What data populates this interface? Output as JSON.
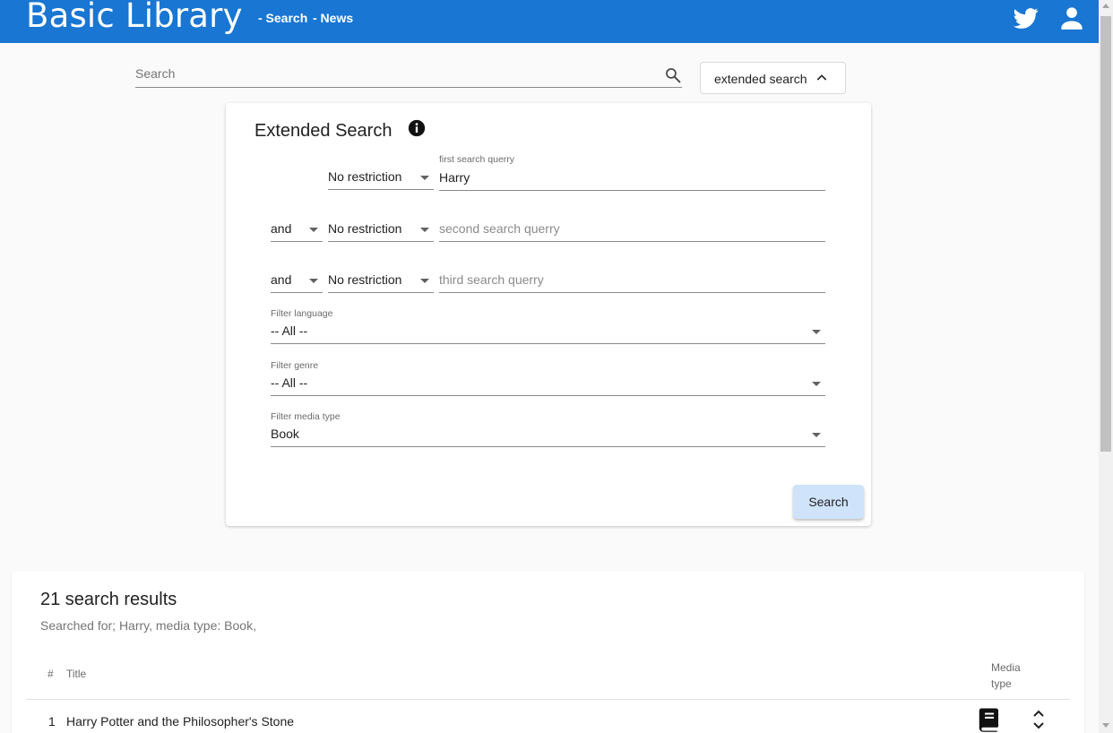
{
  "header": {
    "brand": "Basic Library",
    "nav": [
      {
        "label": "- Search"
      },
      {
        "label": "- News"
      }
    ],
    "icons": [
      "twitter-icon",
      "account-icon"
    ],
    "accent_color": "#1976d2"
  },
  "search": {
    "placeholder": "Search",
    "value": "",
    "extended_button_label": "extended search"
  },
  "extended": {
    "title": "Extended Search",
    "rows": [
      {
        "operator": null,
        "restriction": "No restriction",
        "label": "first search querry",
        "value": "Harry",
        "placeholder": ""
      },
      {
        "operator": "and",
        "restriction": "No restriction",
        "label": "",
        "value": "",
        "placeholder": "second search querry"
      },
      {
        "operator": "and",
        "restriction": "No restriction",
        "label": "",
        "value": "",
        "placeholder": "third search querry"
      }
    ],
    "filters": [
      {
        "label": "Filter language",
        "value": "-- All --"
      },
      {
        "label": "Filter genre",
        "value": "-- All --"
      },
      {
        "label": "Filter media type",
        "value": "Book"
      }
    ],
    "submit_label": "Search"
  },
  "results": {
    "title": "21 search results",
    "subtitle": "Searched for; Harry, media type: Book,",
    "columns": {
      "num": "#",
      "title": "Title",
      "media": "Media type"
    },
    "rows": [
      {
        "num": "1",
        "title": "Harry Potter and the Philosopher's Stone",
        "media_icon": "book-icon"
      }
    ]
  }
}
